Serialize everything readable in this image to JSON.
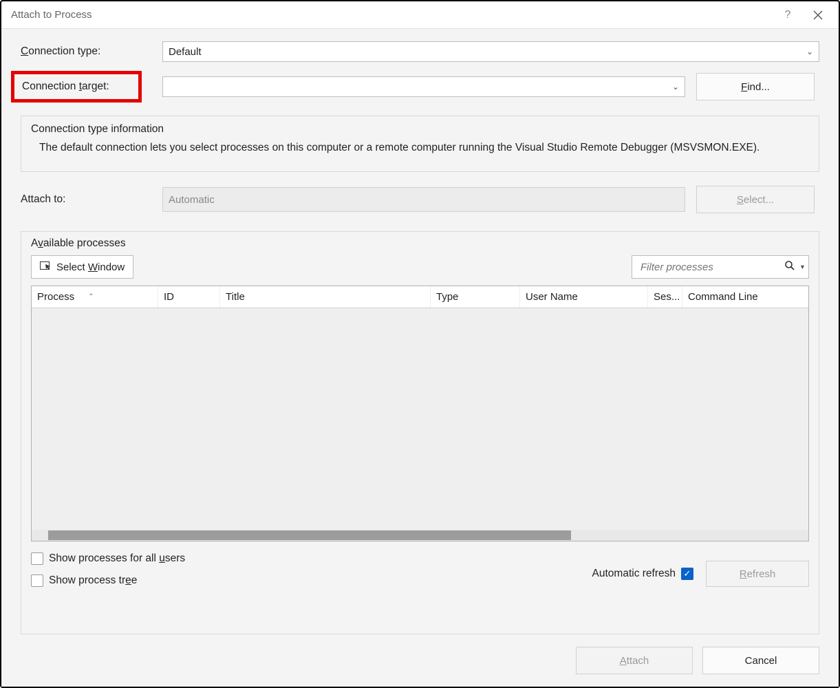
{
  "titlebar": {
    "title": "Attach to Process"
  },
  "labels": {
    "connection_type": "Connection type:",
    "connection_target": "Connection target:",
    "attach_to": "Attach to:",
    "available_processes": "Available processes"
  },
  "connection_type": {
    "value": "Default"
  },
  "connection_target": {
    "value": ""
  },
  "find_button": "Find...",
  "info_group": {
    "legend": "Connection type information",
    "text": "The default connection lets you select processes on this computer or a remote computer running the Visual Studio Remote Debugger (MSVSMON.EXE)."
  },
  "attach_to": {
    "value": "Automatic"
  },
  "select_button": "Select...",
  "select_window_button": "Select Window",
  "filter_placeholder": "Filter processes",
  "columns": {
    "process": "Process",
    "id": "ID",
    "title": "Title",
    "type": "Type",
    "user_name": "User Name",
    "session": "Ses...",
    "command_line": "Command Line"
  },
  "checkboxes": {
    "show_all_users": "Show processes for all users",
    "show_tree": "Show process tree",
    "auto_refresh": "Automatic refresh"
  },
  "refresh_button": "Refresh",
  "footer": {
    "attach": "Attach",
    "cancel": "Cancel"
  }
}
